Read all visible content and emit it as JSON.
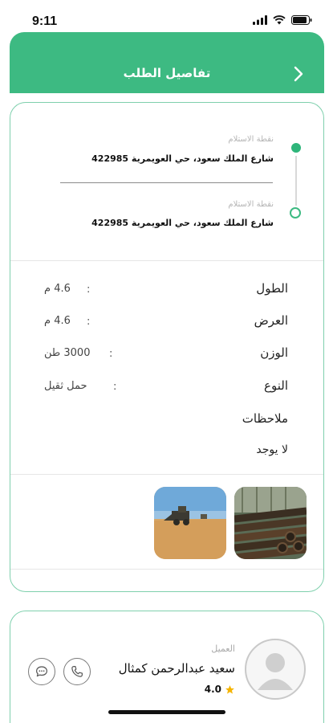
{
  "status_bar": {
    "time": "9:11"
  },
  "header": {
    "title": "تفاصيل الطلب"
  },
  "route": {
    "pickup": {
      "label": "نقطة الاستلام",
      "address": "شارع الملك سعود، حي العويمرية 422985"
    },
    "dropoff": {
      "label": "نقطة الاستلام",
      "address": "شارع الملك سعود، حي العويمرية 422985"
    }
  },
  "specs": {
    "length": {
      "label": "الطول",
      "value": "4.6 م"
    },
    "width": {
      "label": "العرض",
      "value": "4.6 م"
    },
    "weight": {
      "label": "الوزن",
      "value": "3000 طن"
    },
    "type": {
      "label": "النوع",
      "value": "حمل ثقيل"
    },
    "notes": {
      "label": "ملاحظات",
      "value": "لا يوجد"
    },
    "separator": ":"
  },
  "client": {
    "label": "العميل",
    "name": "سعيد عبدالرحمن كمثال",
    "rating": "4.0"
  },
  "colors": {
    "accent": "#3dba82",
    "border": "#7fd0ad",
    "star": "#f5b400"
  },
  "icons": [
    "chevron-right-icon",
    "signal-icon",
    "wifi-icon",
    "battery-icon",
    "user-avatar-icon",
    "phone-icon",
    "chat-icon",
    "star-icon"
  ]
}
